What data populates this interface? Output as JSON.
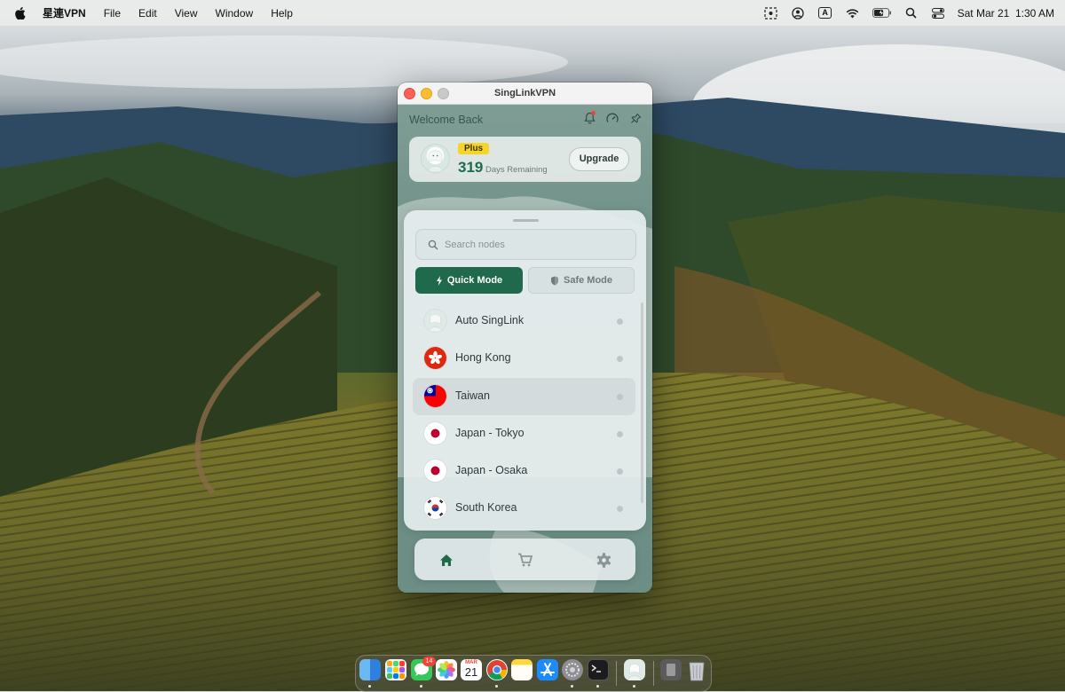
{
  "menubar": {
    "app_name": "星連VPN",
    "menus": [
      "File",
      "Edit",
      "View",
      "Window",
      "Help"
    ],
    "input_source": "A",
    "clock": "Sat Mar 21  1:30 AM"
  },
  "window": {
    "title": "SingLinkVPN"
  },
  "header": {
    "welcome": "Welcome Back",
    "icons": [
      "bell-icon",
      "speedometer-icon",
      "pin-icon"
    ]
  },
  "plan": {
    "badge": "Plus",
    "days": "319",
    "days_label": "Days Remaining",
    "upgrade_label": "Upgrade"
  },
  "search": {
    "placeholder": "Search nodes"
  },
  "modes": {
    "quick_label": "Quick Mode",
    "safe_label": "Safe Mode",
    "active": "quick"
  },
  "nodes": [
    {
      "name": "Auto SingLink",
      "flag": "auto"
    },
    {
      "name": "Hong Kong",
      "flag": "hk"
    },
    {
      "name": "Taiwan",
      "flag": "tw",
      "selected": true
    },
    {
      "name": "Japan - Tokyo",
      "flag": "jp"
    },
    {
      "name": "Japan - Osaka",
      "flag": "jp"
    },
    {
      "name": "South Korea",
      "flag": "kr"
    }
  ],
  "tabs": [
    "home-icon",
    "cart-icon",
    "settings-icon"
  ],
  "dock": {
    "messages_badge": "14",
    "calendar_month": "MAR",
    "calendar_day": "21"
  },
  "colors": {
    "accent": "#1f6a4d",
    "plus_badge": "#f5d52a",
    "close": "#fe5f57",
    "minimize": "#febc2e"
  }
}
